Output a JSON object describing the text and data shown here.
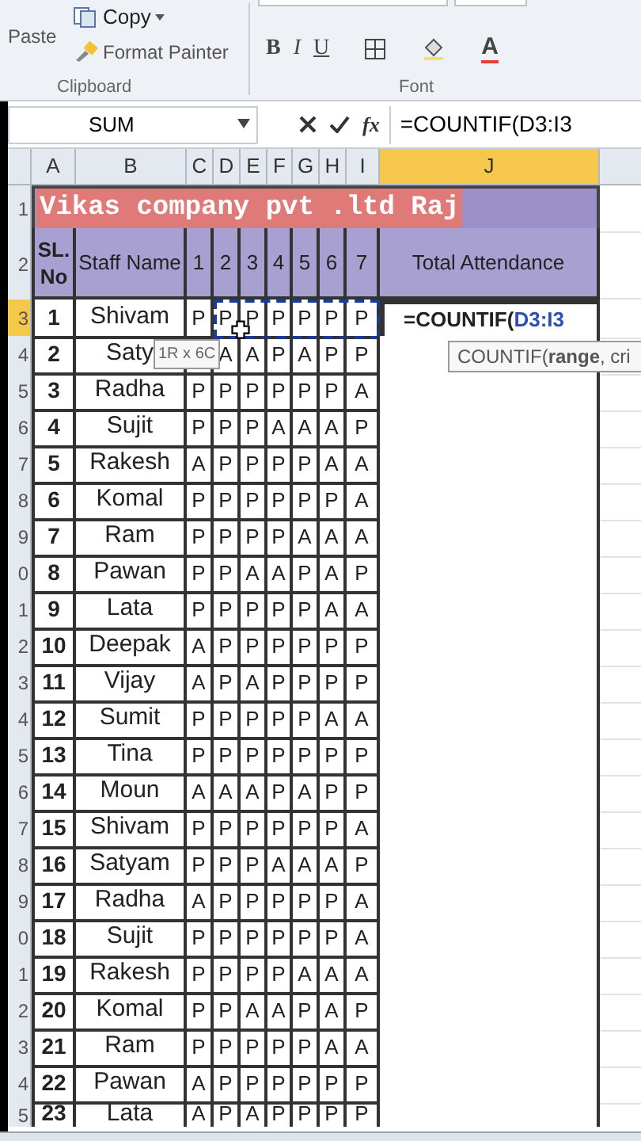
{
  "ribbon": {
    "clipboard": {
      "paste": "Paste",
      "copy": "Copy",
      "format_painter": "Format Painter",
      "label": "Clipboard"
    },
    "font": {
      "bold": "B",
      "italic": "I",
      "underline": "U",
      "font_color": "A",
      "label": "Font"
    }
  },
  "formula_bar": {
    "name_box": "SUM",
    "fx": "fx",
    "formula": "=COUNTIF(D3:I3"
  },
  "columns": [
    {
      "label": "A",
      "selected": false
    },
    {
      "label": "B",
      "selected": false
    },
    {
      "label": "C",
      "selected": false
    },
    {
      "label": "D",
      "selected": false
    },
    {
      "label": "E",
      "selected": false
    },
    {
      "label": "F",
      "selected": false
    },
    {
      "label": "G",
      "selected": false
    },
    {
      "label": "H",
      "selected": false
    },
    {
      "label": "I",
      "selected": false
    },
    {
      "label": "J",
      "selected": true
    }
  ],
  "title": "Vikas company pvt .ltd Raj",
  "header": {
    "row_number": "2",
    "sl": "SL. No",
    "name": "Staff Name",
    "days": [
      "1",
      "2",
      "3",
      "4",
      "5",
      "6",
      "7"
    ],
    "total": "Total Attendance"
  },
  "title_row_number": "1",
  "rows": [
    {
      "row_number": "3",
      "sl": "1",
      "name": "Shivam",
      "days": [
        "P",
        "P",
        "P",
        "P",
        "P",
        "P",
        "P"
      ],
      "selected": true,
      "in_formula_range": true,
      "formula_prefix": "=COUNTIF(",
      "formula_ref": "D3:I3"
    },
    {
      "row_number": "4",
      "sl": "2",
      "name": "Saty",
      "days": [
        "A",
        "A",
        "P",
        "A",
        "P",
        "P"
      ],
      "selected": false,
      "in_formula_range": false
    },
    {
      "row_number": "5",
      "sl": "3",
      "name": "Radha",
      "days": [
        "P",
        "P",
        "P",
        "P",
        "P",
        "P",
        "A"
      ],
      "selected": false,
      "in_formula_range": false
    },
    {
      "row_number": "6",
      "sl": "4",
      "name": "Sujit",
      "days": [
        "P",
        "P",
        "P",
        "A",
        "A",
        "A",
        "P"
      ],
      "selected": false,
      "in_formula_range": false
    },
    {
      "row_number": "7",
      "sl": "5",
      "name": "Rakesh",
      "days": [
        "A",
        "P",
        "P",
        "P",
        "P",
        "A",
        "A"
      ],
      "selected": false,
      "in_formula_range": false
    },
    {
      "row_number": "8",
      "sl": "6",
      "name": "Komal",
      "days": [
        "P",
        "P",
        "P",
        "P",
        "P",
        "P",
        "A"
      ],
      "selected": false,
      "in_formula_range": false
    },
    {
      "row_number": "9",
      "sl": "7",
      "name": "Ram",
      "days": [
        "P",
        "P",
        "P",
        "P",
        "A",
        "A",
        "A"
      ],
      "selected": false,
      "in_formula_range": false
    },
    {
      "row_number": "0",
      "sl": "8",
      "name": "Pawan",
      "days": [
        "P",
        "P",
        "A",
        "A",
        "P",
        "A",
        "P"
      ],
      "selected": false,
      "in_formula_range": false
    },
    {
      "row_number": "1",
      "sl": "9",
      "name": "Lata",
      "days": [
        "P",
        "P",
        "P",
        "P",
        "P",
        "A",
        "A"
      ],
      "selected": false,
      "in_formula_range": false
    },
    {
      "row_number": "2",
      "sl": "10",
      "name": "Deepak",
      "days": [
        "A",
        "P",
        "P",
        "P",
        "P",
        "P",
        "P"
      ],
      "selected": false,
      "in_formula_range": false
    },
    {
      "row_number": "3",
      "sl": "11",
      "name": "Vijay",
      "days": [
        "A",
        "P",
        "A",
        "P",
        "P",
        "P",
        "P"
      ],
      "selected": false,
      "in_formula_range": false
    },
    {
      "row_number": "4",
      "sl": "12",
      "name": "Sumit",
      "days": [
        "P",
        "P",
        "P",
        "P",
        "P",
        "A",
        "A"
      ],
      "selected": false,
      "in_formula_range": false
    },
    {
      "row_number": "5",
      "sl": "13",
      "name": "Tina",
      "days": [
        "P",
        "P",
        "P",
        "P",
        "P",
        "P",
        "P"
      ],
      "selected": false,
      "in_formula_range": false
    },
    {
      "row_number": "6",
      "sl": "14",
      "name": "Moun",
      "days": [
        "A",
        "A",
        "A",
        "P",
        "A",
        "P",
        "P"
      ],
      "selected": false,
      "in_formula_range": false
    },
    {
      "row_number": "7",
      "sl": "15",
      "name": "Shivam",
      "days": [
        "P",
        "P",
        "P",
        "P",
        "P",
        "P",
        "A"
      ],
      "selected": false,
      "in_formula_range": false
    },
    {
      "row_number": "8",
      "sl": "16",
      "name": "Satyam",
      "days": [
        "P",
        "P",
        "P",
        "A",
        "A",
        "A",
        "P"
      ],
      "selected": false,
      "in_formula_range": false
    },
    {
      "row_number": "9",
      "sl": "17",
      "name": "Radha",
      "days": [
        "A",
        "P",
        "P",
        "P",
        "P",
        "P",
        "A"
      ],
      "selected": false,
      "in_formula_range": false
    },
    {
      "row_number": "0",
      "sl": "18",
      "name": "Sujit",
      "days": [
        "P",
        "P",
        "P",
        "P",
        "P",
        "P",
        "A"
      ],
      "selected": false,
      "in_formula_range": false
    },
    {
      "row_number": "1",
      "sl": "19",
      "name": "Rakesh",
      "days": [
        "P",
        "P",
        "P",
        "P",
        "A",
        "A",
        "A"
      ],
      "selected": false,
      "in_formula_range": false
    },
    {
      "row_number": "2",
      "sl": "20",
      "name": "Komal",
      "days": [
        "P",
        "P",
        "A",
        "A",
        "P",
        "A",
        "P"
      ],
      "selected": false,
      "in_formula_range": false
    },
    {
      "row_number": "3",
      "sl": "21",
      "name": "Ram",
      "days": [
        "P",
        "P",
        "P",
        "P",
        "P",
        "A",
        "A"
      ],
      "selected": false,
      "in_formula_range": false
    },
    {
      "row_number": "4",
      "sl": "22",
      "name": "Pawan",
      "days": [
        "A",
        "P",
        "P",
        "P",
        "P",
        "P",
        "P"
      ],
      "selected": false,
      "in_formula_range": false
    },
    {
      "row_number": "5",
      "sl": "23",
      "name": "Lata",
      "days": [
        "A",
        "P",
        "A",
        "P",
        "P",
        "P",
        "P"
      ],
      "selected": false,
      "in_formula_range": false
    }
  ],
  "selection_tooltip": "1R x 6C",
  "function_tooltip": "COUNTIF(**range**, cri"
}
